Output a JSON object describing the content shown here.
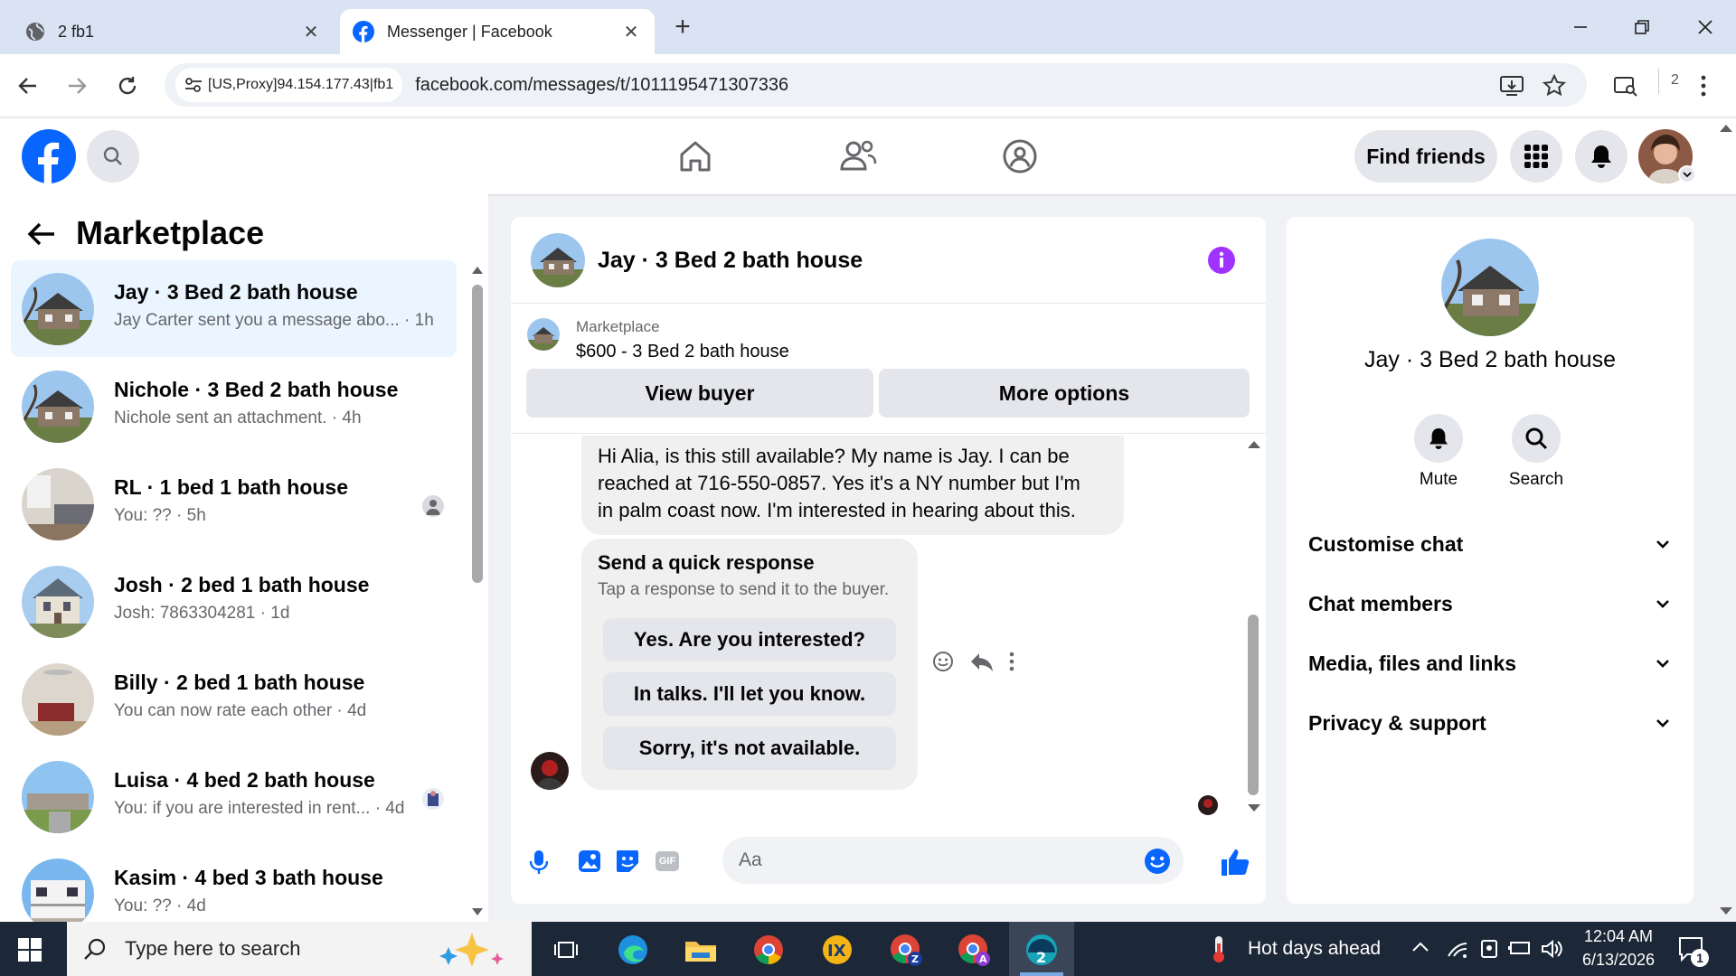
{
  "browser": {
    "tabs": [
      {
        "title": "2 fb1",
        "active": false
      },
      {
        "title": "Messenger | Facebook",
        "active": true
      }
    ],
    "proxy_label": "[US,Proxy]94.154.177.43|fb1",
    "url": "facebook.com/messages/t/1011195471307336",
    "profile_count": "2"
  },
  "header": {
    "find_friends": "Find friends"
  },
  "left_panel": {
    "title": "Marketplace",
    "conversations": [
      {
        "name": "Jay · 3 Bed 2 bath house",
        "snippet": "Jay Carter sent you a message abo...",
        "time": " · 1h",
        "selected": true
      },
      {
        "name": "Nichole · 3 Bed 2 bath house",
        "snippet": "Nichole sent an attachment.",
        "time": " · 4h"
      },
      {
        "name": "RL · 1 bed 1 bath house",
        "snippet": "You: ??",
        "time": " · 5h"
      },
      {
        "name": "Josh · 2 bed 1 bath house",
        "snippet": "Josh: 7863304281",
        "time": " · 1d"
      },
      {
        "name": "Billy · 2 bed 1 bath house",
        "snippet": "You can now rate each other",
        "time": " · 4d"
      },
      {
        "name": "Luisa · 4 bed 2 bath house",
        "snippet": "You: if you are interested in rent...",
        "time": " · 4d"
      },
      {
        "name": "Kasim · 4 bed 3 bath house",
        "snippet": "You: ??",
        "time": " · 4d"
      }
    ]
  },
  "chat": {
    "title": "Jay · 3 Bed 2 bath house",
    "marketplace_label": "Marketplace",
    "listing": "$600 - 3 Bed 2 bath house",
    "view_buyer": "View buyer",
    "more_options": "More options",
    "message_lines": [
      "Hi Alia, is this still available? My name is Jay. I can be",
      "reached at 716-550-0857. Yes it's a NY number but I'm",
      "in palm coast now. I'm interested in hearing about this."
    ],
    "quick_response_title": "Send a quick response",
    "quick_response_subtitle": "Tap a response to send it to the buyer.",
    "quick_responses": [
      "Yes. Are you interested?",
      "In talks. I'll let you know.",
      "Sorry, it's not available."
    ],
    "input_placeholder": "Aa"
  },
  "right_panel": {
    "title": "Jay · 3 Bed 2 bath house",
    "mute": "Mute",
    "search": "Search",
    "sections": [
      "Customise chat",
      "Chat members",
      "Media, files and links",
      "Privacy & support"
    ]
  },
  "taskbar": {
    "search_placeholder": "Type here to search",
    "weather": "Hot days ahead",
    "time": "12:04 AM",
    "date": "6/13/2026",
    "notification_count": "1"
  },
  "colors": {
    "facebook_blue": "#0866ff",
    "selected_row": "#ebf5ff",
    "info_purple": "#a033ff",
    "taskbar": "#1c2737"
  }
}
